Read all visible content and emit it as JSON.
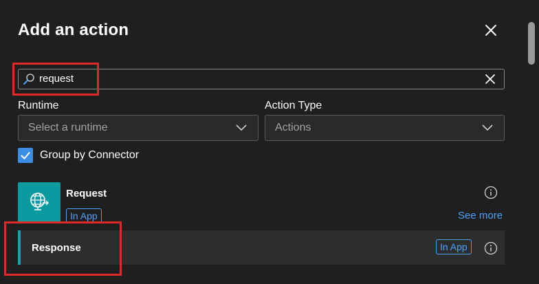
{
  "panel": {
    "title": "Add an action"
  },
  "search": {
    "value": "request"
  },
  "filters": {
    "runtime_label": "Runtime",
    "runtime_placeholder": "Select a runtime",
    "action_type_label": "Action Type",
    "action_type_placeholder": "Actions"
  },
  "group_by": {
    "label": "Group by Connector",
    "checked": true
  },
  "connector": {
    "name": "Request",
    "badge": "In App",
    "see_more": "See more",
    "icon": "globe-network-icon"
  },
  "actions": [
    {
      "name": "Response",
      "badge": "In App"
    }
  ],
  "colors": {
    "background": "#1f1f1f",
    "accent_blue": "#4aa3ff",
    "connector_teal": "#0a9aa0",
    "highlight_red": "#e02a2a"
  }
}
